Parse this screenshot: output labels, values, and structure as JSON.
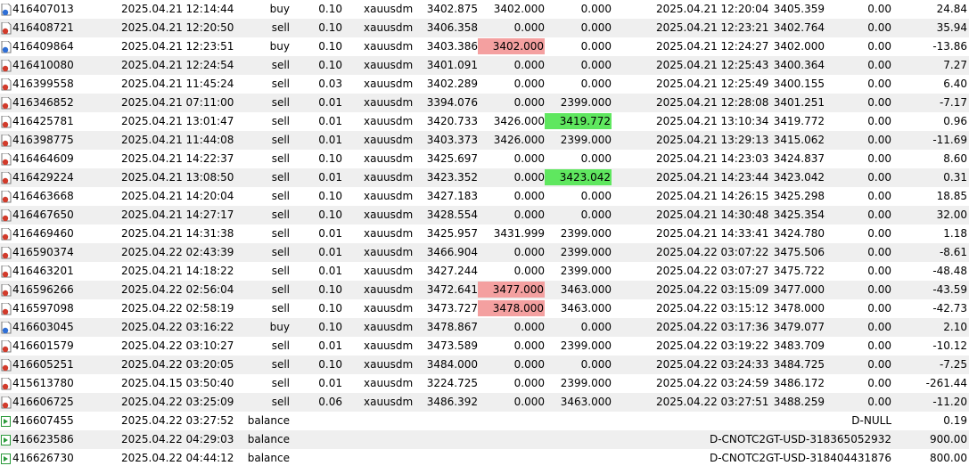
{
  "colors": {
    "row_alt": "#efefef",
    "sl_hit": "#f4a0a0",
    "tp_hit": "#5fe75f",
    "buy_icon": "#2f6fd6",
    "sell_icon": "#d23b2b",
    "balance_icon": "#2a9a3a"
  },
  "trades": [
    {
      "icon": "buy-icon",
      "ticket": "416407013",
      "open_time": "2025.04.21 12:14:44",
      "type": "buy",
      "volume": "0.10",
      "symbol": "xauusdm",
      "open_price": "3402.875",
      "sl": "3402.000",
      "tp": "0.000",
      "close_time": "2025.04.21 12:20:04",
      "close_price": "3405.359",
      "swap": "0.00",
      "profit": "24.84",
      "hl": ""
    },
    {
      "icon": "sell-icon",
      "ticket": "416408721",
      "open_time": "2025.04.21 12:20:50",
      "type": "sell",
      "volume": "0.10",
      "symbol": "xauusdm",
      "open_price": "3406.358",
      "sl": "0.000",
      "tp": "0.000",
      "close_time": "2025.04.21 12:23:21",
      "close_price": "3402.764",
      "swap": "0.00",
      "profit": "35.94",
      "hl": ""
    },
    {
      "icon": "buy-icon",
      "ticket": "416409864",
      "open_time": "2025.04.21 12:23:51",
      "type": "buy",
      "volume": "0.10",
      "symbol": "xauusdm",
      "open_price": "3403.386",
      "sl": "3402.000",
      "tp": "0.000",
      "close_time": "2025.04.21 12:24:27",
      "close_price": "3402.000",
      "swap": "0.00",
      "profit": "-13.86",
      "hl": "sl"
    },
    {
      "icon": "sell-icon",
      "ticket": "416410080",
      "open_time": "2025.04.21 12:24:54",
      "type": "sell",
      "volume": "0.10",
      "symbol": "xauusdm",
      "open_price": "3401.091",
      "sl": "0.000",
      "tp": "0.000",
      "close_time": "2025.04.21 12:25:43",
      "close_price": "3400.364",
      "swap": "0.00",
      "profit": "7.27",
      "hl": ""
    },
    {
      "icon": "sell-icon",
      "ticket": "416399558",
      "open_time": "2025.04.21 11:45:24",
      "type": "sell",
      "volume": "0.03",
      "symbol": "xauusdm",
      "open_price": "3402.289",
      "sl": "0.000",
      "tp": "0.000",
      "close_time": "2025.04.21 12:25:49",
      "close_price": "3400.155",
      "swap": "0.00",
      "profit": "6.40",
      "hl": ""
    },
    {
      "icon": "sell-icon",
      "ticket": "416346852",
      "open_time": "2025.04.21 07:11:00",
      "type": "sell",
      "volume": "0.01",
      "symbol": "xauusdm",
      "open_price": "3394.076",
      "sl": "0.000",
      "tp": "2399.000",
      "close_time": "2025.04.21 12:28:08",
      "close_price": "3401.251",
      "swap": "0.00",
      "profit": "-7.17",
      "hl": ""
    },
    {
      "icon": "sell-icon",
      "ticket": "416425781",
      "open_time": "2025.04.21 13:01:47",
      "type": "sell",
      "volume": "0.01",
      "symbol": "xauusdm",
      "open_price": "3420.733",
      "sl": "3426.000",
      "tp": "3419.772",
      "close_time": "2025.04.21 13:10:34",
      "close_price": "3419.772",
      "swap": "0.00",
      "profit": "0.96",
      "hl": "tp"
    },
    {
      "icon": "sell-icon",
      "ticket": "416398775",
      "open_time": "2025.04.21 11:44:08",
      "type": "sell",
      "volume": "0.01",
      "symbol": "xauusdm",
      "open_price": "3403.373",
      "sl": "3426.000",
      "tp": "2399.000",
      "close_time": "2025.04.21 13:29:13",
      "close_price": "3415.062",
      "swap": "0.00",
      "profit": "-11.69",
      "hl": ""
    },
    {
      "icon": "sell-icon",
      "ticket": "416464609",
      "open_time": "2025.04.21 14:22:37",
      "type": "sell",
      "volume": "0.10",
      "symbol": "xauusdm",
      "open_price": "3425.697",
      "sl": "0.000",
      "tp": "0.000",
      "close_time": "2025.04.21 14:23:03",
      "close_price": "3424.837",
      "swap": "0.00",
      "profit": "8.60",
      "hl": ""
    },
    {
      "icon": "sell-icon",
      "ticket": "416429224",
      "open_time": "2025.04.21 13:08:50",
      "type": "sell",
      "volume": "0.01",
      "symbol": "xauusdm",
      "open_price": "3423.352",
      "sl": "0.000",
      "tp": "3423.042",
      "close_time": "2025.04.21 14:23:44",
      "close_price": "3423.042",
      "swap": "0.00",
      "profit": "0.31",
      "hl": "tp"
    },
    {
      "icon": "sell-icon",
      "ticket": "416463668",
      "open_time": "2025.04.21 14:20:04",
      "type": "sell",
      "volume": "0.10",
      "symbol": "xauusdm",
      "open_price": "3427.183",
      "sl": "0.000",
      "tp": "0.000",
      "close_time": "2025.04.21 14:26:15",
      "close_price": "3425.298",
      "swap": "0.00",
      "profit": "18.85",
      "hl": ""
    },
    {
      "icon": "sell-icon",
      "ticket": "416467650",
      "open_time": "2025.04.21 14:27:17",
      "type": "sell",
      "volume": "0.10",
      "symbol": "xauusdm",
      "open_price": "3428.554",
      "sl": "0.000",
      "tp": "0.000",
      "close_time": "2025.04.21 14:30:48",
      "close_price": "3425.354",
      "swap": "0.00",
      "profit": "32.00",
      "hl": ""
    },
    {
      "icon": "sell-icon",
      "ticket": "416469460",
      "open_time": "2025.04.21 14:31:38",
      "type": "sell",
      "volume": "0.01",
      "symbol": "xauusdm",
      "open_price": "3425.957",
      "sl": "3431.999",
      "tp": "2399.000",
      "close_time": "2025.04.21 14:33:41",
      "close_price": "3424.780",
      "swap": "0.00",
      "profit": "1.18",
      "hl": ""
    },
    {
      "icon": "sell-icon",
      "ticket": "416590374",
      "open_time": "2025.04.22 02:43:39",
      "type": "sell",
      "volume": "0.01",
      "symbol": "xauusdm",
      "open_price": "3466.904",
      "sl": "0.000",
      "tp": "2399.000",
      "close_time": "2025.04.22 03:07:22",
      "close_price": "3475.506",
      "swap": "0.00",
      "profit": "-8.61",
      "hl": ""
    },
    {
      "icon": "sell-icon",
      "ticket": "416463201",
      "open_time": "2025.04.21 14:18:22",
      "type": "sell",
      "volume": "0.01",
      "symbol": "xauusdm",
      "open_price": "3427.244",
      "sl": "0.000",
      "tp": "2399.000",
      "close_time": "2025.04.22 03:07:27",
      "close_price": "3475.722",
      "swap": "0.00",
      "profit": "-48.48",
      "hl": ""
    },
    {
      "icon": "sell-icon",
      "ticket": "416596266",
      "open_time": "2025.04.22 02:56:04",
      "type": "sell",
      "volume": "0.10",
      "symbol": "xauusdm",
      "open_price": "3472.641",
      "sl": "3477.000",
      "tp": "3463.000",
      "close_time": "2025.04.22 03:15:09",
      "close_price": "3477.000",
      "swap": "0.00",
      "profit": "-43.59",
      "hl": "sl"
    },
    {
      "icon": "sell-icon",
      "ticket": "416597098",
      "open_time": "2025.04.22 02:58:19",
      "type": "sell",
      "volume": "0.10",
      "symbol": "xauusdm",
      "open_price": "3473.727",
      "sl": "3478.000",
      "tp": "3463.000",
      "close_time": "2025.04.22 03:15:12",
      "close_price": "3478.000",
      "swap": "0.00",
      "profit": "-42.73",
      "hl": "sl"
    },
    {
      "icon": "buy-icon",
      "ticket": "416603045",
      "open_time": "2025.04.22 03:16:22",
      "type": "buy",
      "volume": "0.10",
      "symbol": "xauusdm",
      "open_price": "3478.867",
      "sl": "0.000",
      "tp": "0.000",
      "close_time": "2025.04.22 03:17:36",
      "close_price": "3479.077",
      "swap": "0.00",
      "profit": "2.10",
      "hl": ""
    },
    {
      "icon": "sell-icon",
      "ticket": "416601579",
      "open_time": "2025.04.22 03:10:27",
      "type": "sell",
      "volume": "0.01",
      "symbol": "xauusdm",
      "open_price": "3473.589",
      "sl": "0.000",
      "tp": "2399.000",
      "close_time": "2025.04.22 03:19:22",
      "close_price": "3483.709",
      "swap": "0.00",
      "profit": "-10.12",
      "hl": ""
    },
    {
      "icon": "sell-icon",
      "ticket": "416605251",
      "open_time": "2025.04.22 03:20:05",
      "type": "sell",
      "volume": "0.10",
      "symbol": "xauusdm",
      "open_price": "3484.000",
      "sl": "0.000",
      "tp": "0.000",
      "close_time": "2025.04.22 03:24:33",
      "close_price": "3484.725",
      "swap": "0.00",
      "profit": "-7.25",
      "hl": ""
    },
    {
      "icon": "sell-icon",
      "ticket": "415613780",
      "open_time": "2025.04.15 03:50:40",
      "type": "sell",
      "volume": "0.01",
      "symbol": "xauusdm",
      "open_price": "3224.725",
      "sl": "0.000",
      "tp": "2399.000",
      "close_time": "2025.04.22 03:24:59",
      "close_price": "3486.172",
      "swap": "0.00",
      "profit": "-261.44",
      "hl": ""
    },
    {
      "icon": "sell-icon",
      "ticket": "416606725",
      "open_time": "2025.04.22 03:25:09",
      "type": "sell",
      "volume": "0.06",
      "symbol": "xauusdm",
      "open_price": "3486.392",
      "sl": "0.000",
      "tp": "3463.000",
      "close_time": "2025.04.22 03:27:51",
      "close_price": "3488.259",
      "swap": "0.00",
      "profit": "-11.20",
      "hl": ""
    }
  ],
  "balances": [
    {
      "icon": "balance-icon",
      "ticket": "416607455",
      "time": "2025.04.22 03:27:52",
      "type": "balance",
      "comment": "D-NULL",
      "amount": "0.19"
    },
    {
      "icon": "balance-icon",
      "ticket": "416623586",
      "time": "2025.04.22 04:29:03",
      "type": "balance",
      "comment": "D-CNOTC2GT-USD-318365052932",
      "amount": "900.00"
    },
    {
      "icon": "balance-icon",
      "ticket": "416626730",
      "time": "2025.04.22 04:44:12",
      "type": "balance",
      "comment": "D-CNOTC2GT-USD-318404431876",
      "amount": "800.00"
    }
  ]
}
